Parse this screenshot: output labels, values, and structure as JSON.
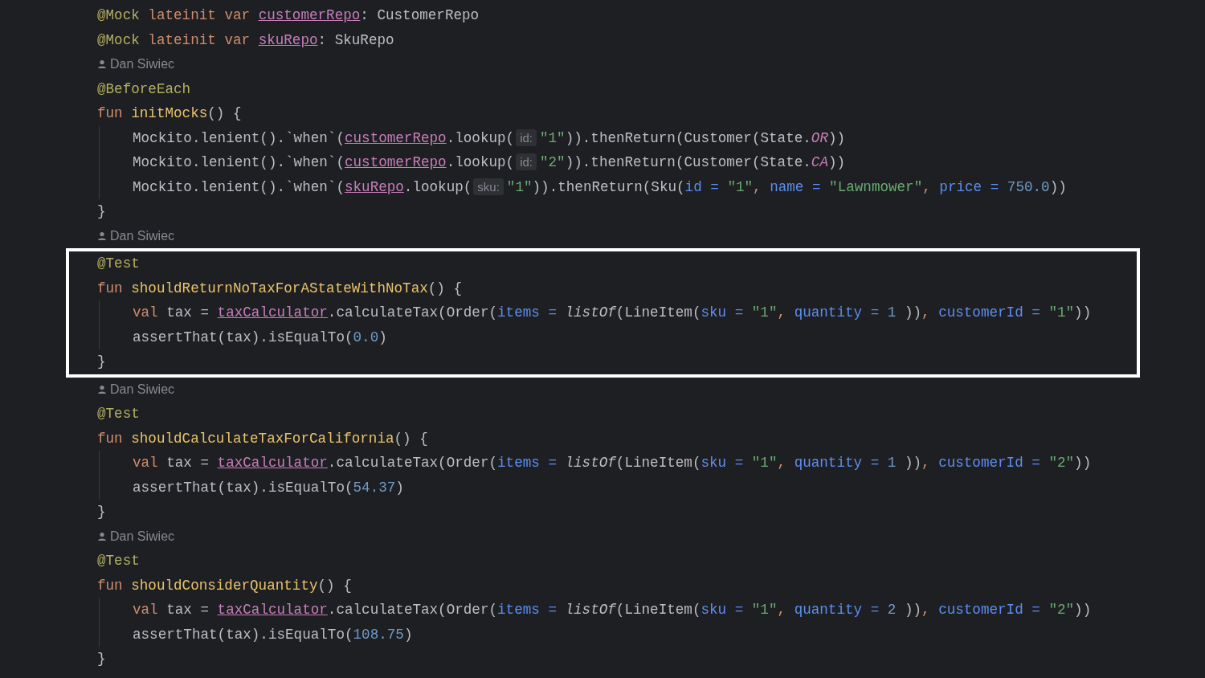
{
  "editor": {
    "sections": [
      {
        "highlighted": false,
        "lines": [
          {
            "kind": "code",
            "tokens": [
              {
                "kind": "annotation",
                "text": "@Mock "
              },
              {
                "kind": "keyword",
                "text": "lateinit var "
              },
              {
                "kind": "property",
                "text": "customerRepo"
              },
              {
                "kind": "plain",
                "text": ": CustomerRepo"
              }
            ]
          },
          {
            "kind": "code",
            "tokens": [
              {
                "kind": "annotation",
                "text": "@Mock "
              },
              {
                "kind": "keyword",
                "text": "lateinit var "
              },
              {
                "kind": "property",
                "text": "skuRepo"
              },
              {
                "kind": "plain",
                "text": ": SkuRepo"
              }
            ]
          },
          {
            "kind": "author",
            "text": "Dan Siwiec"
          },
          {
            "kind": "code",
            "tokens": [
              {
                "kind": "annotation",
                "text": "@BeforeEach"
              }
            ]
          },
          {
            "kind": "code",
            "tokens": [
              {
                "kind": "keyword",
                "text": "fun "
              },
              {
                "kind": "function",
                "text": "initMocks"
              },
              {
                "kind": "plain",
                "text": "() {"
              }
            ],
            "children": [
              {
                "kind": "code",
                "tokens": [
                  {
                    "kind": "plain",
                    "text": "Mockito.lenient().`when`("
                  },
                  {
                    "kind": "property",
                    "text": "customerRepo"
                  },
                  {
                    "kind": "plain",
                    "text": ".lookup("
                  },
                  {
                    "kind": "hint",
                    "text": "id:"
                  },
                  {
                    "kind": "string",
                    "text": "\"1\""
                  },
                  {
                    "kind": "plain",
                    "text": ")).thenReturn(Customer(State."
                  },
                  {
                    "kind": "enum",
                    "text": "OR"
                  },
                  {
                    "kind": "plain",
                    "text": "))"
                  }
                ]
              },
              {
                "kind": "code",
                "tokens": [
                  {
                    "kind": "plain",
                    "text": "Mockito.lenient().`when`("
                  },
                  {
                    "kind": "property",
                    "text": "customerRepo"
                  },
                  {
                    "kind": "plain",
                    "text": ".lookup("
                  },
                  {
                    "kind": "hint",
                    "text": "id:"
                  },
                  {
                    "kind": "string",
                    "text": "\"2\""
                  },
                  {
                    "kind": "plain",
                    "text": ")).thenReturn(Customer(State."
                  },
                  {
                    "kind": "enum",
                    "text": "CA"
                  },
                  {
                    "kind": "plain",
                    "text": "))"
                  }
                ]
              },
              {
                "kind": "code",
                "tokens": [
                  {
                    "kind": "plain",
                    "text": "Mockito.lenient().`when`("
                  },
                  {
                    "kind": "property",
                    "text": "skuRepo"
                  },
                  {
                    "kind": "plain",
                    "text": ".lookup("
                  },
                  {
                    "kind": "hint",
                    "text": "sku:"
                  },
                  {
                    "kind": "string",
                    "text": "\"1\""
                  },
                  {
                    "kind": "plain",
                    "text": ")).thenReturn(Sku("
                  },
                  {
                    "kind": "named",
                    "text": "id = "
                  },
                  {
                    "kind": "string",
                    "text": "\"1\""
                  },
                  {
                    "kind": "keyword",
                    "text": ", "
                  },
                  {
                    "kind": "named",
                    "text": "name = "
                  },
                  {
                    "kind": "string",
                    "text": "\"Lawnmower\""
                  },
                  {
                    "kind": "keyword",
                    "text": ", "
                  },
                  {
                    "kind": "named",
                    "text": "price = "
                  },
                  {
                    "kind": "number",
                    "text": "750.0"
                  },
                  {
                    "kind": "plain",
                    "text": "))"
                  }
                ]
              }
            ]
          },
          {
            "kind": "code",
            "tokens": [
              {
                "kind": "plain",
                "text": "}"
              }
            ]
          },
          {
            "kind": "author",
            "text": "Dan Siwiec"
          }
        ]
      },
      {
        "highlighted": true,
        "lines": [
          {
            "kind": "code",
            "tokens": [
              {
                "kind": "annotation",
                "text": "@Test"
              }
            ]
          },
          {
            "kind": "code",
            "tokens": [
              {
                "kind": "keyword",
                "text": "fun "
              },
              {
                "kind": "function",
                "text": "shouldReturnNoTaxForAStateWithNoTax"
              },
              {
                "kind": "plain",
                "text": "() {"
              }
            ],
            "children": [
              {
                "kind": "code",
                "tokens": [
                  {
                    "kind": "keyword",
                    "text": "val "
                  },
                  {
                    "kind": "plain",
                    "text": "tax = "
                  },
                  {
                    "kind": "property",
                    "text": "taxCalculator"
                  },
                  {
                    "kind": "plain",
                    "text": ".calculateTax(Order("
                  },
                  {
                    "kind": "named",
                    "text": "items = "
                  },
                  {
                    "kind": "italic",
                    "text": "listOf"
                  },
                  {
                    "kind": "plain",
                    "text": "(LineItem("
                  },
                  {
                    "kind": "named",
                    "text": "sku = "
                  },
                  {
                    "kind": "string",
                    "text": "\"1\""
                  },
                  {
                    "kind": "keyword",
                    "text": ", "
                  },
                  {
                    "kind": "named",
                    "text": "quantity = "
                  },
                  {
                    "kind": "number",
                    "text": "1"
                  },
                  {
                    "kind": "plain",
                    "text": " ))"
                  },
                  {
                    "kind": "keyword",
                    "text": ", "
                  },
                  {
                    "kind": "named",
                    "text": "customerId = "
                  },
                  {
                    "kind": "string",
                    "text": "\"1\""
                  },
                  {
                    "kind": "plain",
                    "text": "))"
                  }
                ]
              },
              {
                "kind": "code",
                "tokens": [
                  {
                    "kind": "plain",
                    "text": "assertThat(tax).isEqualTo("
                  },
                  {
                    "kind": "number",
                    "text": "0.0"
                  },
                  {
                    "kind": "plain",
                    "text": ")"
                  }
                ]
              }
            ]
          },
          {
            "kind": "code",
            "tokens": [
              {
                "kind": "plain",
                "text": "}"
              }
            ]
          }
        ]
      },
      {
        "highlighted": false,
        "lines": [
          {
            "kind": "author",
            "text": "Dan Siwiec"
          },
          {
            "kind": "code",
            "tokens": [
              {
                "kind": "annotation",
                "text": "@Test"
              }
            ]
          },
          {
            "kind": "code",
            "tokens": [
              {
                "kind": "keyword",
                "text": "fun "
              },
              {
                "kind": "function",
                "text": "shouldCalculateTaxForCalifornia"
              },
              {
                "kind": "plain",
                "text": "() {"
              }
            ],
            "children": [
              {
                "kind": "code",
                "tokens": [
                  {
                    "kind": "keyword",
                    "text": "val "
                  },
                  {
                    "kind": "plain",
                    "text": "tax = "
                  },
                  {
                    "kind": "property",
                    "text": "taxCalculator"
                  },
                  {
                    "kind": "plain",
                    "text": ".calculateTax(Order("
                  },
                  {
                    "kind": "named",
                    "text": "items = "
                  },
                  {
                    "kind": "italic",
                    "text": "listOf"
                  },
                  {
                    "kind": "plain",
                    "text": "(LineItem("
                  },
                  {
                    "kind": "named",
                    "text": "sku = "
                  },
                  {
                    "kind": "string",
                    "text": "\"1\""
                  },
                  {
                    "kind": "keyword",
                    "text": ", "
                  },
                  {
                    "kind": "named",
                    "text": "quantity = "
                  },
                  {
                    "kind": "number",
                    "text": "1"
                  },
                  {
                    "kind": "plain",
                    "text": " ))"
                  },
                  {
                    "kind": "keyword",
                    "text": ", "
                  },
                  {
                    "kind": "named",
                    "text": "customerId = "
                  },
                  {
                    "kind": "string",
                    "text": "\"2\""
                  },
                  {
                    "kind": "plain",
                    "text": "))"
                  }
                ]
              },
              {
                "kind": "code",
                "tokens": [
                  {
                    "kind": "plain",
                    "text": "assertThat(tax).isEqualTo("
                  },
                  {
                    "kind": "number",
                    "text": "54.37"
                  },
                  {
                    "kind": "plain",
                    "text": ")"
                  }
                ]
              }
            ]
          },
          {
            "kind": "code",
            "tokens": [
              {
                "kind": "plain",
                "text": "}"
              }
            ]
          },
          {
            "kind": "author",
            "text": "Dan Siwiec"
          },
          {
            "kind": "code",
            "tokens": [
              {
                "kind": "annotation",
                "text": "@Test"
              }
            ]
          },
          {
            "kind": "code",
            "tokens": [
              {
                "kind": "keyword",
                "text": "fun "
              },
              {
                "kind": "function",
                "text": "shouldConsiderQuantity"
              },
              {
                "kind": "plain",
                "text": "() {"
              }
            ],
            "children": [
              {
                "kind": "code",
                "tokens": [
                  {
                    "kind": "keyword",
                    "text": "val "
                  },
                  {
                    "kind": "plain",
                    "text": "tax = "
                  },
                  {
                    "kind": "property",
                    "text": "taxCalculator"
                  },
                  {
                    "kind": "plain",
                    "text": ".calculateTax(Order("
                  },
                  {
                    "kind": "named",
                    "text": "items = "
                  },
                  {
                    "kind": "italic",
                    "text": "listOf"
                  },
                  {
                    "kind": "plain",
                    "text": "(LineItem("
                  },
                  {
                    "kind": "named",
                    "text": "sku = "
                  },
                  {
                    "kind": "string",
                    "text": "\"1\""
                  },
                  {
                    "kind": "keyword",
                    "text": ", "
                  },
                  {
                    "kind": "named",
                    "text": "quantity = "
                  },
                  {
                    "kind": "number",
                    "text": "2"
                  },
                  {
                    "kind": "plain",
                    "text": " ))"
                  },
                  {
                    "kind": "keyword",
                    "text": ", "
                  },
                  {
                    "kind": "named",
                    "text": "customerId = "
                  },
                  {
                    "kind": "string",
                    "text": "\"2\""
                  },
                  {
                    "kind": "plain",
                    "text": "))"
                  }
                ]
              },
              {
                "kind": "code",
                "tokens": [
                  {
                    "kind": "plain",
                    "text": "assertThat(tax).isEqualTo("
                  },
                  {
                    "kind": "number",
                    "text": "108.75"
                  },
                  {
                    "kind": "plain",
                    "text": ")"
                  }
                ]
              }
            ]
          },
          {
            "kind": "code",
            "tokens": [
              {
                "kind": "plain",
                "text": "}"
              }
            ]
          }
        ]
      }
    ]
  }
}
